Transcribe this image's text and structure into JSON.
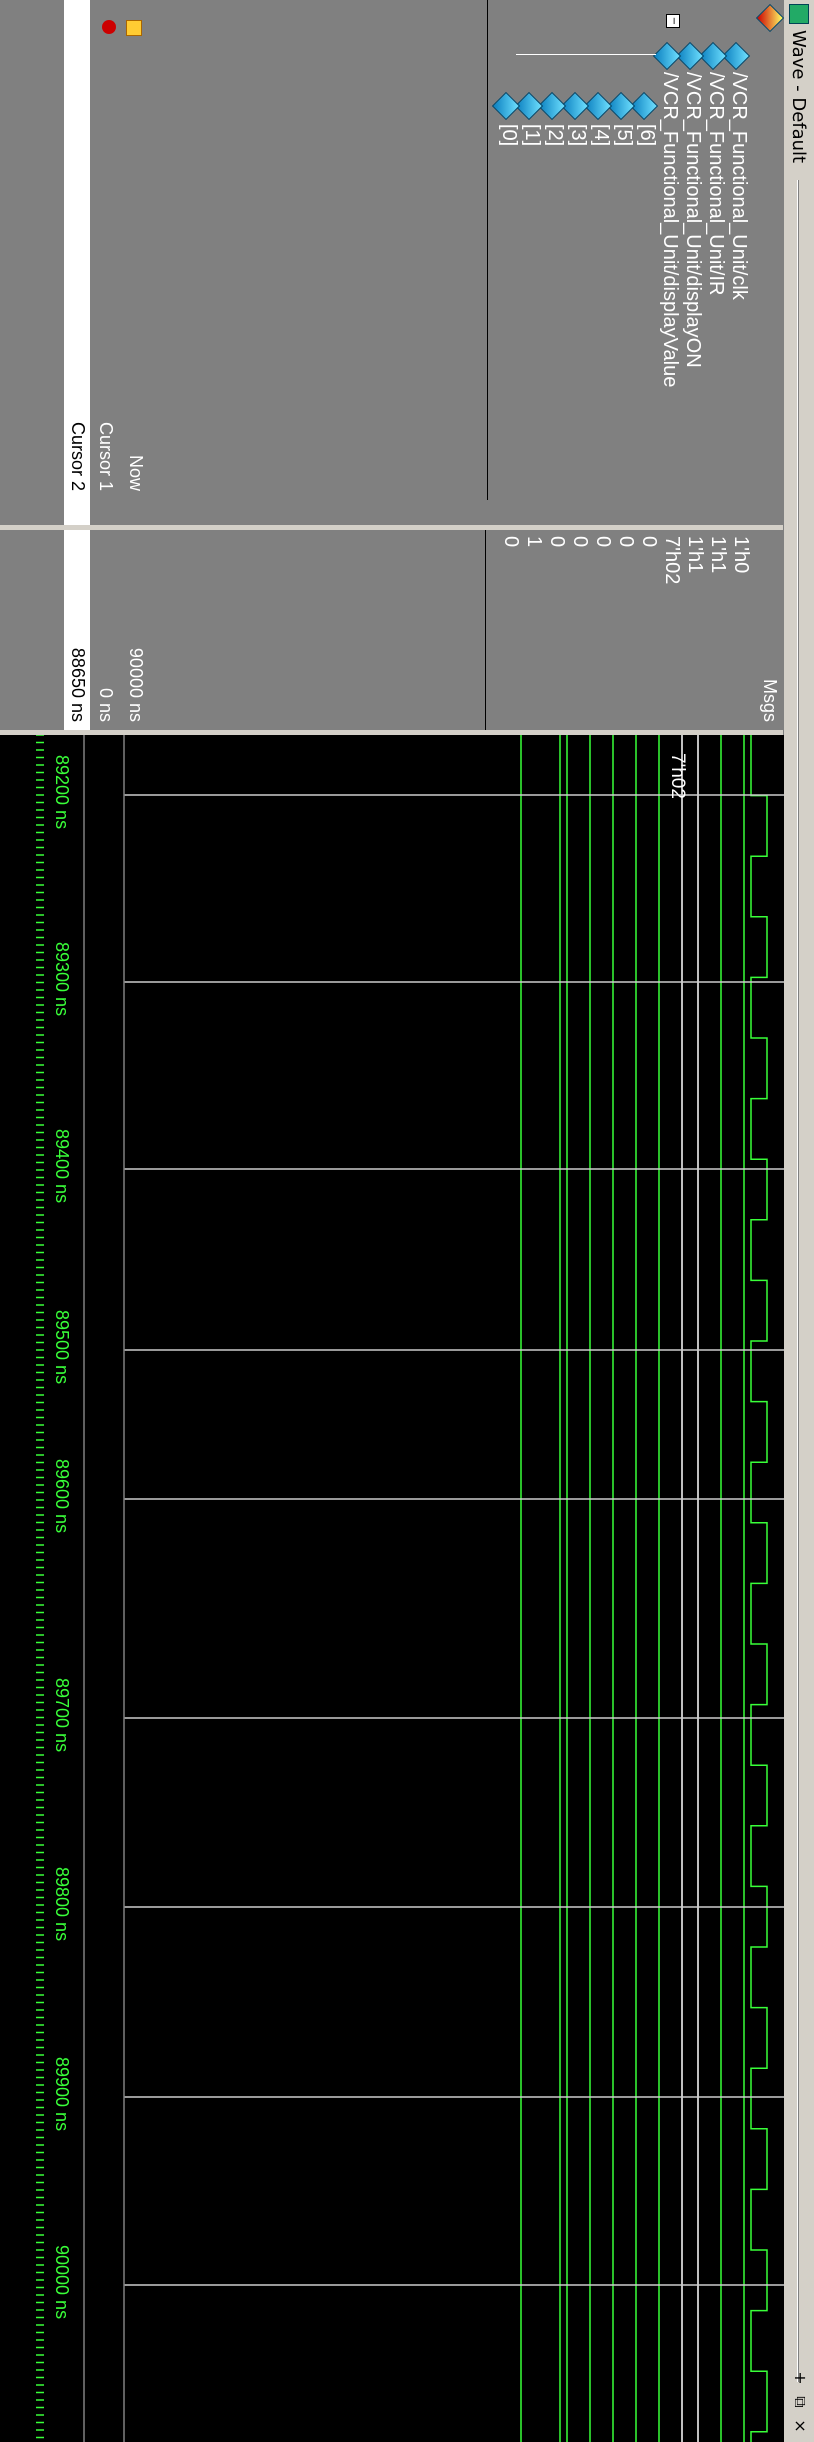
{
  "window": {
    "title": "Wave - Default",
    "controls": [
      "+",
      "⧉",
      "×"
    ]
  },
  "name_pane": {
    "signals": [
      {
        "name": "/VCR_Functional_Unit/clk",
        "expanded": false
      },
      {
        "name": "/VCR_Functional_Unit/IR",
        "expanded": false
      },
      {
        "name": "/VCR_Functional_Unit/displayON",
        "expanded": false
      },
      {
        "name": "/VCR_Functional_Unit/displayValue",
        "expanded": true
      }
    ],
    "children": [
      "[6]",
      "[5]",
      "[4]",
      "[3]",
      "[2]",
      "[1]",
      "[0]"
    ],
    "cursor_rows": {
      "now": "Now",
      "cursor1": "Cursor 1",
      "cursor2": "Cursor 2"
    }
  },
  "msgs_pane": {
    "header": "Msgs",
    "values": [
      "1'h0",
      "1'h1",
      "1'h1",
      "7'h02",
      "0",
      "0",
      "0",
      "0",
      "0",
      "1",
      "0"
    ],
    "cursor_values": {
      "now": "90000 ns",
      "cursor1": "0 ns",
      "cursor2": "88650 ns"
    }
  },
  "wave_pane": {
    "bus_label": "7'h02",
    "time_ticks": [
      "89200 ns",
      "89300 ns",
      "89400 ns",
      "89500 ns",
      "89600 ns",
      "89700 ns",
      "89800 ns",
      "89900 ns",
      "90000 ns"
    ]
  },
  "colors": {
    "wave": "#39ff39",
    "bus": "#ffffff",
    "bg": "#000000",
    "panel": "#808080",
    "chrome": "#d4d0c8"
  }
}
